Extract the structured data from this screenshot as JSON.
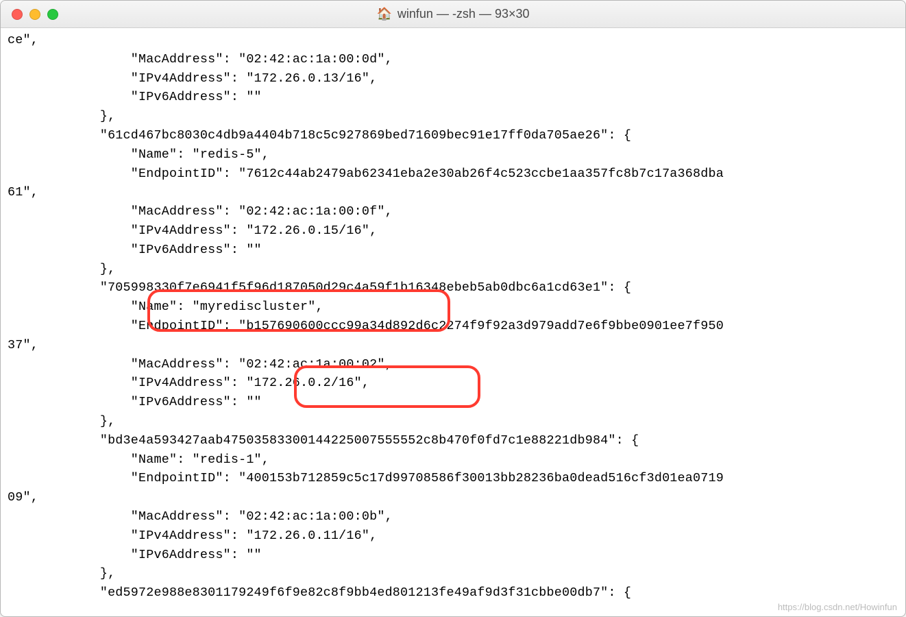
{
  "window": {
    "title": "winfun — -zsh — 93×30",
    "traffic_lights": {
      "close": "close",
      "minimize": "minimize",
      "zoom": "zoom"
    },
    "home_icon": "🏠"
  },
  "terminal": {
    "lines": [
      "ce\",",
      "                \"MacAddress\": \"02:42:ac:1a:00:0d\",",
      "                \"IPv4Address\": \"172.26.0.13/16\",",
      "                \"IPv6Address\": \"\"",
      "            },",
      "            \"61cd467bc8030c4db9a4404b718c5c927869bed71609bec91e17ff0da705ae26\": {",
      "                \"Name\": \"redis-5\",",
      "                \"EndpointID\": \"7612c44ab2479ab62341eba2e30ab26f4c523ccbe1aa357fc8b7c17a368dba",
      "61\",",
      "                \"MacAddress\": \"02:42:ac:1a:00:0f\",",
      "                \"IPv4Address\": \"172.26.0.15/16\",",
      "                \"IPv6Address\": \"\"",
      "            },",
      "            \"705998330f7e6941f5f96d187050d29c4a59f1b16348ebeb5ab0dbc6a1cd63e1\": {",
      "                \"Name\": \"myrediscluster\",",
      "                \"EndpointID\": \"b157690600ccc99a34d892d6c2274f9f92a3d979add7e6f9bbe0901ee7f950",
      "37\",",
      "                \"MacAddress\": \"02:42:ac:1a:00:02\",",
      "                \"IPv4Address\": \"172.26.0.2/16\",",
      "                \"IPv6Address\": \"\"",
      "            },",
      "            \"bd3e4a593427aab47503583300144225007555552c8b470f0fd7c1e88221db984\": {",
      "                \"Name\": \"redis-1\",",
      "                \"EndpointID\": \"400153b712859c5c17d99708586f30013bb28236ba0dead516cf3d01ea0719",
      "09\",",
      "                \"MacAddress\": \"02:42:ac:1a:00:0b\",",
      "                \"IPv4Address\": \"172.26.0.11/16\",",
      "                \"IPv6Address\": \"\"",
      "            },",
      "            \"ed5972e988e8301179249f6f9e82c8f9bb4ed801213fe49af9d3f31cbbe00db7\": {"
    ]
  },
  "annotations": {
    "box1": {
      "purpose": "highlight-name-myrediscluster"
    },
    "box2": {
      "purpose": "highlight-ipv4-172.26.0.2/16"
    }
  },
  "watermark": "https://blog.csdn.net/Howinfun"
}
